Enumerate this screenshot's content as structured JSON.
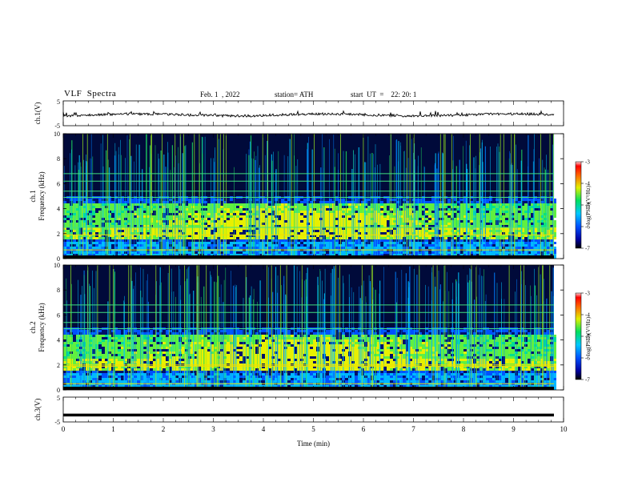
{
  "header": {
    "title": "VLF  Spectra",
    "date": "Feb. 1  , 2022",
    "station": "station= ATH",
    "start": "start  UT  =    22: 20: 1"
  },
  "chart_data": [
    {
      "type": "line",
      "panel": "ch1-waveform",
      "ylabel": "ch.1(V)",
      "ylim": [
        -5,
        5
      ],
      "yticks": [
        "5",
        "-5"
      ],
      "xlim": [
        0,
        10
      ],
      "description_values": {
        "mean": 0,
        "noise_amplitude": 0.8
      },
      "color": "#000000"
    },
    {
      "type": "heatmap",
      "panel": "ch1-spectrogram",
      "ylabel": "Frequency  (kHz)",
      "channel_label": "ch.1",
      "ylim": [
        0,
        10
      ],
      "yticks": [
        "0",
        "2",
        "4",
        "6",
        "8",
        "10"
      ],
      "xlim": [
        0,
        9.8
      ],
      "colorbar": {
        "label": "log(PSD)(V²/Hz)",
        "range": [
          -7,
          -3
        ],
        "ticks": [
          "-3",
          "-4",
          "-5",
          "-6",
          "-7"
        ]
      },
      "enhanced_band_khz": [
        1.5,
        4.5
      ],
      "tone_lines_khz": [
        0.7,
        1.9,
        2.5,
        4.9,
        5.4,
        6.2,
        6.8
      ]
    },
    {
      "type": "heatmap",
      "panel": "ch2-spectrogram",
      "ylabel": "Frequency  (kHz)",
      "channel_label": "ch.2",
      "ylim": [
        0,
        10
      ],
      "yticks": [
        "0",
        "2",
        "4",
        "6",
        "8",
        "10"
      ],
      "xlim": [
        0,
        9.8
      ],
      "colorbar": {
        "label": "log(PSD)(V²/Hz)",
        "range": [
          -7,
          -3
        ],
        "ticks": [
          "-3",
          "-4",
          "-5",
          "-6",
          "-7"
        ]
      },
      "enhanced_band_khz": [
        1.5,
        4.5
      ],
      "tone_lines_khz": [
        0.5,
        1.9,
        2.0,
        4.9,
        5.4,
        6.2,
        6.8
      ]
    },
    {
      "type": "line",
      "panel": "ch3-waveform",
      "ylabel": "ch.3(V)",
      "ylim": [
        -5,
        5
      ],
      "yticks": [
        "5",
        "-5"
      ],
      "xlim": [
        0,
        10
      ],
      "constant_value": -2.2,
      "color": "#000000"
    }
  ],
  "xaxis": {
    "label": "Time  (min)",
    "ticks": [
      "0",
      "1",
      "2",
      "3",
      "4",
      "5",
      "6",
      "7",
      "8",
      "9",
      "10"
    ]
  }
}
